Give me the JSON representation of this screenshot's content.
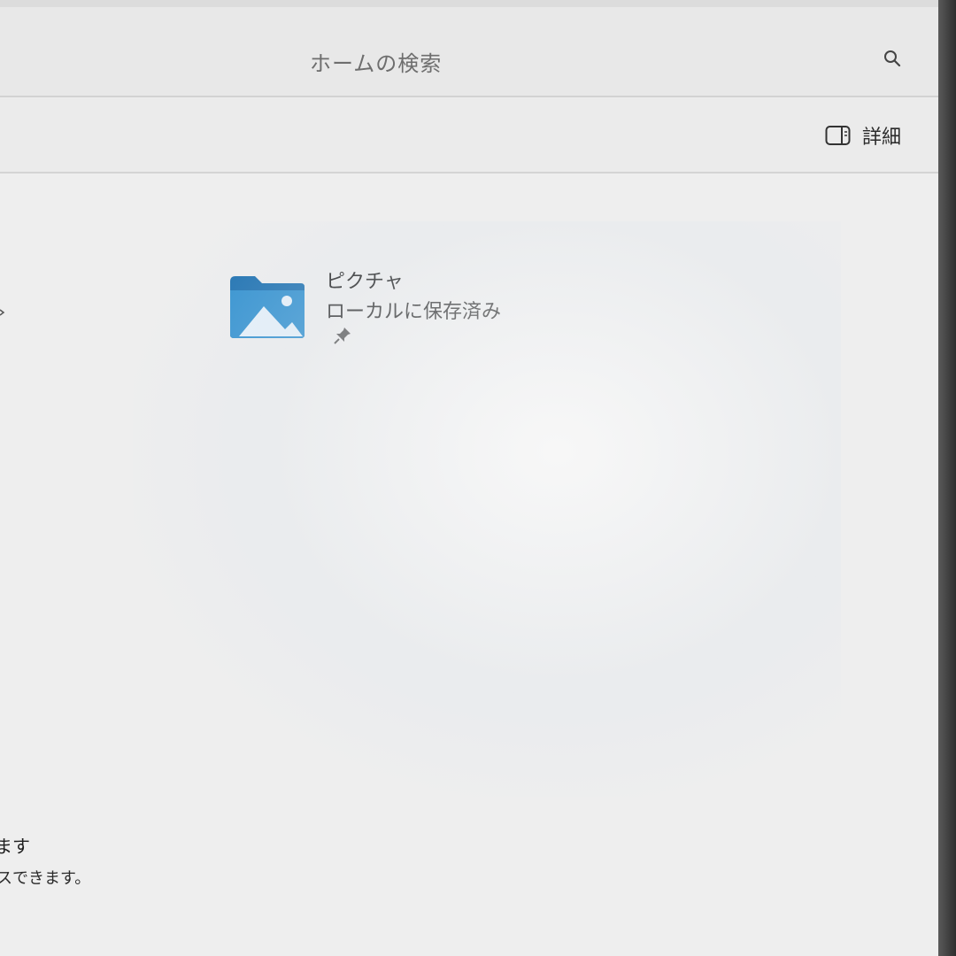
{
  "search": {
    "placeholder": "ホームの検索"
  },
  "toolbar": {
    "details_label": "詳細"
  },
  "folder": {
    "name": "ピクチャ",
    "status": "ローカルに保存済み"
  },
  "side_panel": {
    "line1": "ます",
    "line2": "スできます。"
  },
  "icons": {
    "search": "search-icon",
    "details": "details-pane-icon",
    "folder": "pictures-folder-icon",
    "pin": "pin-icon"
  },
  "colors": {
    "folder_blue": "#1a6fb0",
    "folder_light": "#3aa0d8"
  }
}
